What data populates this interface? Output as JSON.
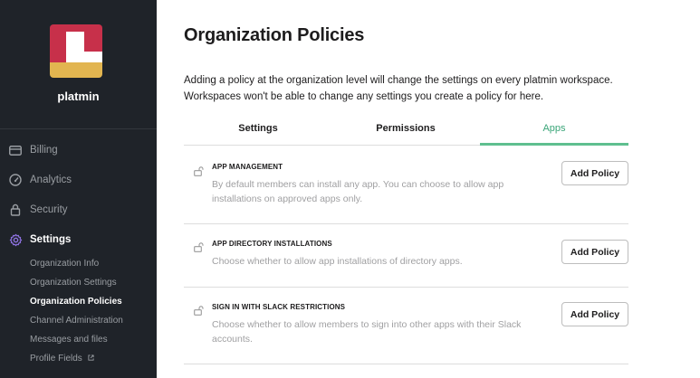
{
  "sidebar": {
    "org_name": "platmin",
    "nav": [
      {
        "label": "Billing",
        "icon": "billing-icon"
      },
      {
        "label": "Analytics",
        "icon": "analytics-icon"
      },
      {
        "label": "Security",
        "icon": "lock-icon"
      },
      {
        "label": "Settings",
        "icon": "gear-icon"
      }
    ],
    "settings_items": [
      {
        "label": "Organization Info"
      },
      {
        "label": "Organization Settings"
      },
      {
        "label": "Organization Policies"
      },
      {
        "label": "Channel Administration"
      },
      {
        "label": "Messages and files"
      },
      {
        "label": "Profile Fields",
        "icon": "external-link-icon"
      }
    ],
    "colors": {
      "logo_red": "#c7304a",
      "logo_yellow": "#e2b550",
      "background": "#1f2329"
    }
  },
  "main": {
    "title": "Organization Policies",
    "intro": "Adding a policy at the organization level will change the settings on every platmin workspace. Workspaces won't be able to change any settings you create a policy for here.",
    "tabs": [
      {
        "label": "Settings"
      },
      {
        "label": "Permissions"
      },
      {
        "label": "Apps"
      }
    ],
    "active_tab": "Apps",
    "accent_color": "#3aa578",
    "policies": [
      {
        "title": "APP MANAGEMENT",
        "description": "By default members can install any app. You can choose to allow app installations on approved apps only.",
        "button": "Add Policy"
      },
      {
        "title": "APP DIRECTORY INSTALLATIONS",
        "description": "Choose whether to allow app installations of directory apps.",
        "button": "Add Policy"
      },
      {
        "title": "SIGN IN WITH SLACK RESTRICTIONS",
        "description": "Choose whether to allow members to sign into other apps with their Slack accounts.",
        "button": "Add Policy"
      }
    ]
  }
}
